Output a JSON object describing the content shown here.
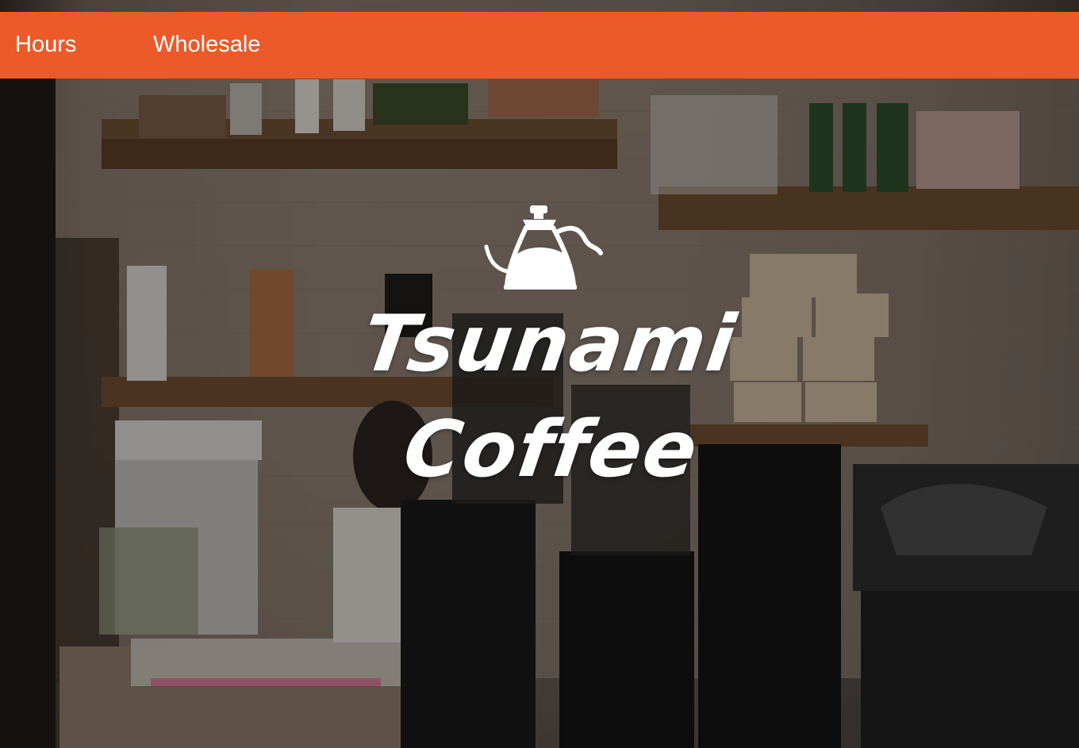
{
  "nav": {
    "items": [
      {
        "label": "Hours"
      },
      {
        "label": "Wholesale"
      }
    ],
    "background_color": "#ec5a2a",
    "text_color": "#ffffff"
  },
  "hero": {
    "brand_line_1": "Tsunami",
    "brand_line_2": "Coffee",
    "logo_icon": "pour-over-kettle-icon",
    "logo_color": "#ffffff"
  }
}
